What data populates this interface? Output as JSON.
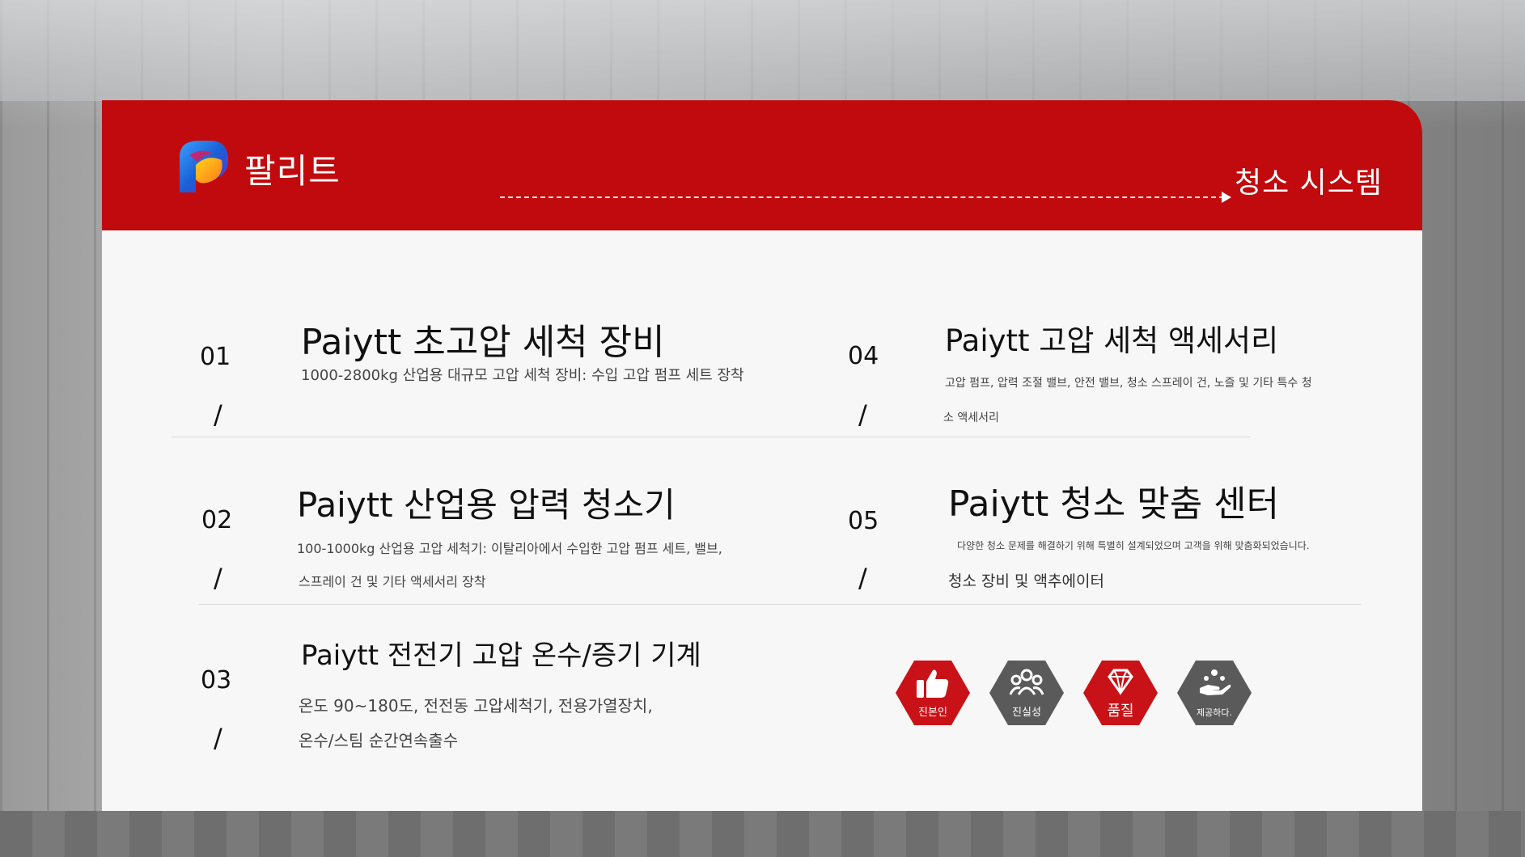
{
  "brand": "팔리트",
  "section_title": "청소 시스템",
  "items": [
    {
      "num": "01",
      "slash": "/",
      "title": "Paiytt 초고압 세척 장비",
      "desc": "1000-2800kg 산업용 대규모 고압 세척 장비: 수입 고압 펌프 세트 장착"
    },
    {
      "num": "02",
      "slash": "/",
      "title": "Paiytt 산업용 압력 청소기",
      "desc_line1": "100-1000kg 산업용 고압 세척기: 이탈리아에서 수입한 고압 펌프 세트, 밸브,",
      "desc_line2": "스프레이 건 및 기타 액세서리 장착"
    },
    {
      "num": "03",
      "slash": "/",
      "title": "Paiytt 전전기 고압 온수/증기 기계",
      "desc_line1": "온도 90~180도, 전전동 고압세척기, 전용가열장치,",
      "desc_line2": "온수/스팀 순간연속출수"
    },
    {
      "num": "04",
      "slash": "/",
      "title": "Paiytt 고압 세척 액세서리",
      "desc_line1": "고압 펌프, 압력 조절 밸브, 안전 밸브, 청소 스프레이 건, 노즐 및 기타 특수 청",
      "desc_line2": "소 액세서리"
    },
    {
      "num": "05",
      "slash": "/",
      "title": "Paiytt 청소 맞춤 센터",
      "desc_line1": "다양한 청소 문제를 해결하기 위해 특별히 설계되었으며 고객을 위해 맞춤화되었습니다.",
      "desc_line2": "청소 장비 및 액추에이터"
    }
  ],
  "badges": [
    {
      "icon": "thumbs-up-icon",
      "label": "진본인",
      "color": "#c91217"
    },
    {
      "icon": "team-icon",
      "label": "진실성",
      "color": "#5a5a5a"
    },
    {
      "icon": "diamond-icon",
      "label": "품질",
      "color": "#c91217"
    },
    {
      "icon": "hand-care-icon",
      "label": "제공하다.",
      "color": "#5a5a5a"
    }
  ]
}
